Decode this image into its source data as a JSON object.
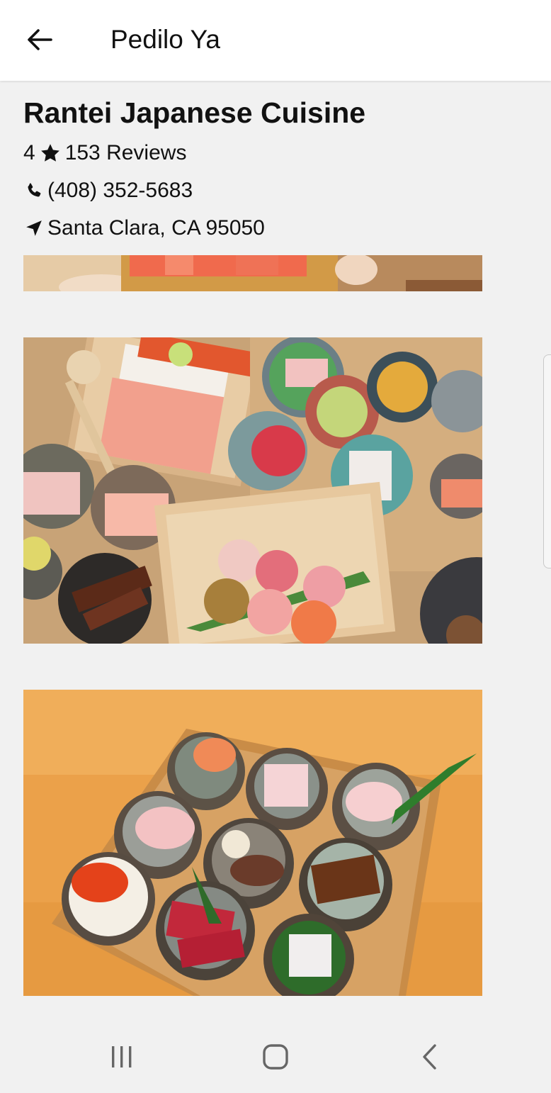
{
  "appbar": {
    "title": "Pedilo Ya",
    "back_icon": "arrow-left-icon"
  },
  "restaurant": {
    "name": "Rantei Japanese Cuisine",
    "rating": "4",
    "reviews": "153 Reviews",
    "phone": "(408) 352-5683",
    "location": "Santa Clara, CA 95050"
  },
  "icons": {
    "star": "star-icon",
    "phone": "phone-icon",
    "location": "location-arrow-icon"
  },
  "photos": [
    {
      "description_icon": "food-photo-salmon"
    },
    {
      "description_icon": "food-photo-bento-box"
    },
    {
      "description_icon": "food-photo-sushi-grid"
    }
  ],
  "navbar": {
    "recents_icon": "recents-icon",
    "home_icon": "home-icon",
    "back_icon": "back-chevron-icon"
  },
  "colors": {
    "background": "#f1f1f1",
    "appbar": "#ffffff",
    "text": "#111111"
  }
}
